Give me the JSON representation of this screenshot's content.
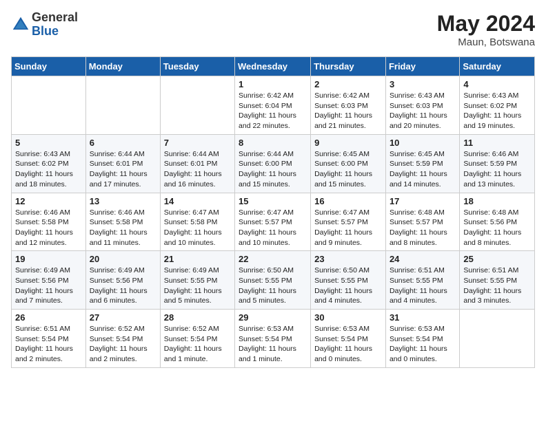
{
  "header": {
    "logo_general": "General",
    "logo_blue": "Blue",
    "month_year": "May 2024",
    "location": "Maun, Botswana"
  },
  "days_of_week": [
    "Sunday",
    "Monday",
    "Tuesday",
    "Wednesday",
    "Thursday",
    "Friday",
    "Saturday"
  ],
  "weeks": [
    [
      {
        "day": "",
        "content": ""
      },
      {
        "day": "",
        "content": ""
      },
      {
        "day": "",
        "content": ""
      },
      {
        "day": "1",
        "content": "Sunrise: 6:42 AM\nSunset: 6:04 PM\nDaylight: 11 hours and 22 minutes."
      },
      {
        "day": "2",
        "content": "Sunrise: 6:42 AM\nSunset: 6:03 PM\nDaylight: 11 hours and 21 minutes."
      },
      {
        "day": "3",
        "content": "Sunrise: 6:43 AM\nSunset: 6:03 PM\nDaylight: 11 hours and 20 minutes."
      },
      {
        "day": "4",
        "content": "Sunrise: 6:43 AM\nSunset: 6:02 PM\nDaylight: 11 hours and 19 minutes."
      }
    ],
    [
      {
        "day": "5",
        "content": "Sunrise: 6:43 AM\nSunset: 6:02 PM\nDaylight: 11 hours and 18 minutes."
      },
      {
        "day": "6",
        "content": "Sunrise: 6:44 AM\nSunset: 6:01 PM\nDaylight: 11 hours and 17 minutes."
      },
      {
        "day": "7",
        "content": "Sunrise: 6:44 AM\nSunset: 6:01 PM\nDaylight: 11 hours and 16 minutes."
      },
      {
        "day": "8",
        "content": "Sunrise: 6:44 AM\nSunset: 6:00 PM\nDaylight: 11 hours and 15 minutes."
      },
      {
        "day": "9",
        "content": "Sunrise: 6:45 AM\nSunset: 6:00 PM\nDaylight: 11 hours and 15 minutes."
      },
      {
        "day": "10",
        "content": "Sunrise: 6:45 AM\nSunset: 5:59 PM\nDaylight: 11 hours and 14 minutes."
      },
      {
        "day": "11",
        "content": "Sunrise: 6:46 AM\nSunset: 5:59 PM\nDaylight: 11 hours and 13 minutes."
      }
    ],
    [
      {
        "day": "12",
        "content": "Sunrise: 6:46 AM\nSunset: 5:58 PM\nDaylight: 11 hours and 12 minutes."
      },
      {
        "day": "13",
        "content": "Sunrise: 6:46 AM\nSunset: 5:58 PM\nDaylight: 11 hours and 11 minutes."
      },
      {
        "day": "14",
        "content": "Sunrise: 6:47 AM\nSunset: 5:58 PM\nDaylight: 11 hours and 10 minutes."
      },
      {
        "day": "15",
        "content": "Sunrise: 6:47 AM\nSunset: 5:57 PM\nDaylight: 11 hours and 10 minutes."
      },
      {
        "day": "16",
        "content": "Sunrise: 6:47 AM\nSunset: 5:57 PM\nDaylight: 11 hours and 9 minutes."
      },
      {
        "day": "17",
        "content": "Sunrise: 6:48 AM\nSunset: 5:57 PM\nDaylight: 11 hours and 8 minutes."
      },
      {
        "day": "18",
        "content": "Sunrise: 6:48 AM\nSunset: 5:56 PM\nDaylight: 11 hours and 8 minutes."
      }
    ],
    [
      {
        "day": "19",
        "content": "Sunrise: 6:49 AM\nSunset: 5:56 PM\nDaylight: 11 hours and 7 minutes."
      },
      {
        "day": "20",
        "content": "Sunrise: 6:49 AM\nSunset: 5:56 PM\nDaylight: 11 hours and 6 minutes."
      },
      {
        "day": "21",
        "content": "Sunrise: 6:49 AM\nSunset: 5:55 PM\nDaylight: 11 hours and 5 minutes."
      },
      {
        "day": "22",
        "content": "Sunrise: 6:50 AM\nSunset: 5:55 PM\nDaylight: 11 hours and 5 minutes."
      },
      {
        "day": "23",
        "content": "Sunrise: 6:50 AM\nSunset: 5:55 PM\nDaylight: 11 hours and 4 minutes."
      },
      {
        "day": "24",
        "content": "Sunrise: 6:51 AM\nSunset: 5:55 PM\nDaylight: 11 hours and 4 minutes."
      },
      {
        "day": "25",
        "content": "Sunrise: 6:51 AM\nSunset: 5:55 PM\nDaylight: 11 hours and 3 minutes."
      }
    ],
    [
      {
        "day": "26",
        "content": "Sunrise: 6:51 AM\nSunset: 5:54 PM\nDaylight: 11 hours and 2 minutes."
      },
      {
        "day": "27",
        "content": "Sunrise: 6:52 AM\nSunset: 5:54 PM\nDaylight: 11 hours and 2 minutes."
      },
      {
        "day": "28",
        "content": "Sunrise: 6:52 AM\nSunset: 5:54 PM\nDaylight: 11 hours and 1 minute."
      },
      {
        "day": "29",
        "content": "Sunrise: 6:53 AM\nSunset: 5:54 PM\nDaylight: 11 hours and 1 minute."
      },
      {
        "day": "30",
        "content": "Sunrise: 6:53 AM\nSunset: 5:54 PM\nDaylight: 11 hours and 0 minutes."
      },
      {
        "day": "31",
        "content": "Sunrise: 6:53 AM\nSunset: 5:54 PM\nDaylight: 11 hours and 0 minutes."
      },
      {
        "day": "",
        "content": ""
      }
    ]
  ]
}
